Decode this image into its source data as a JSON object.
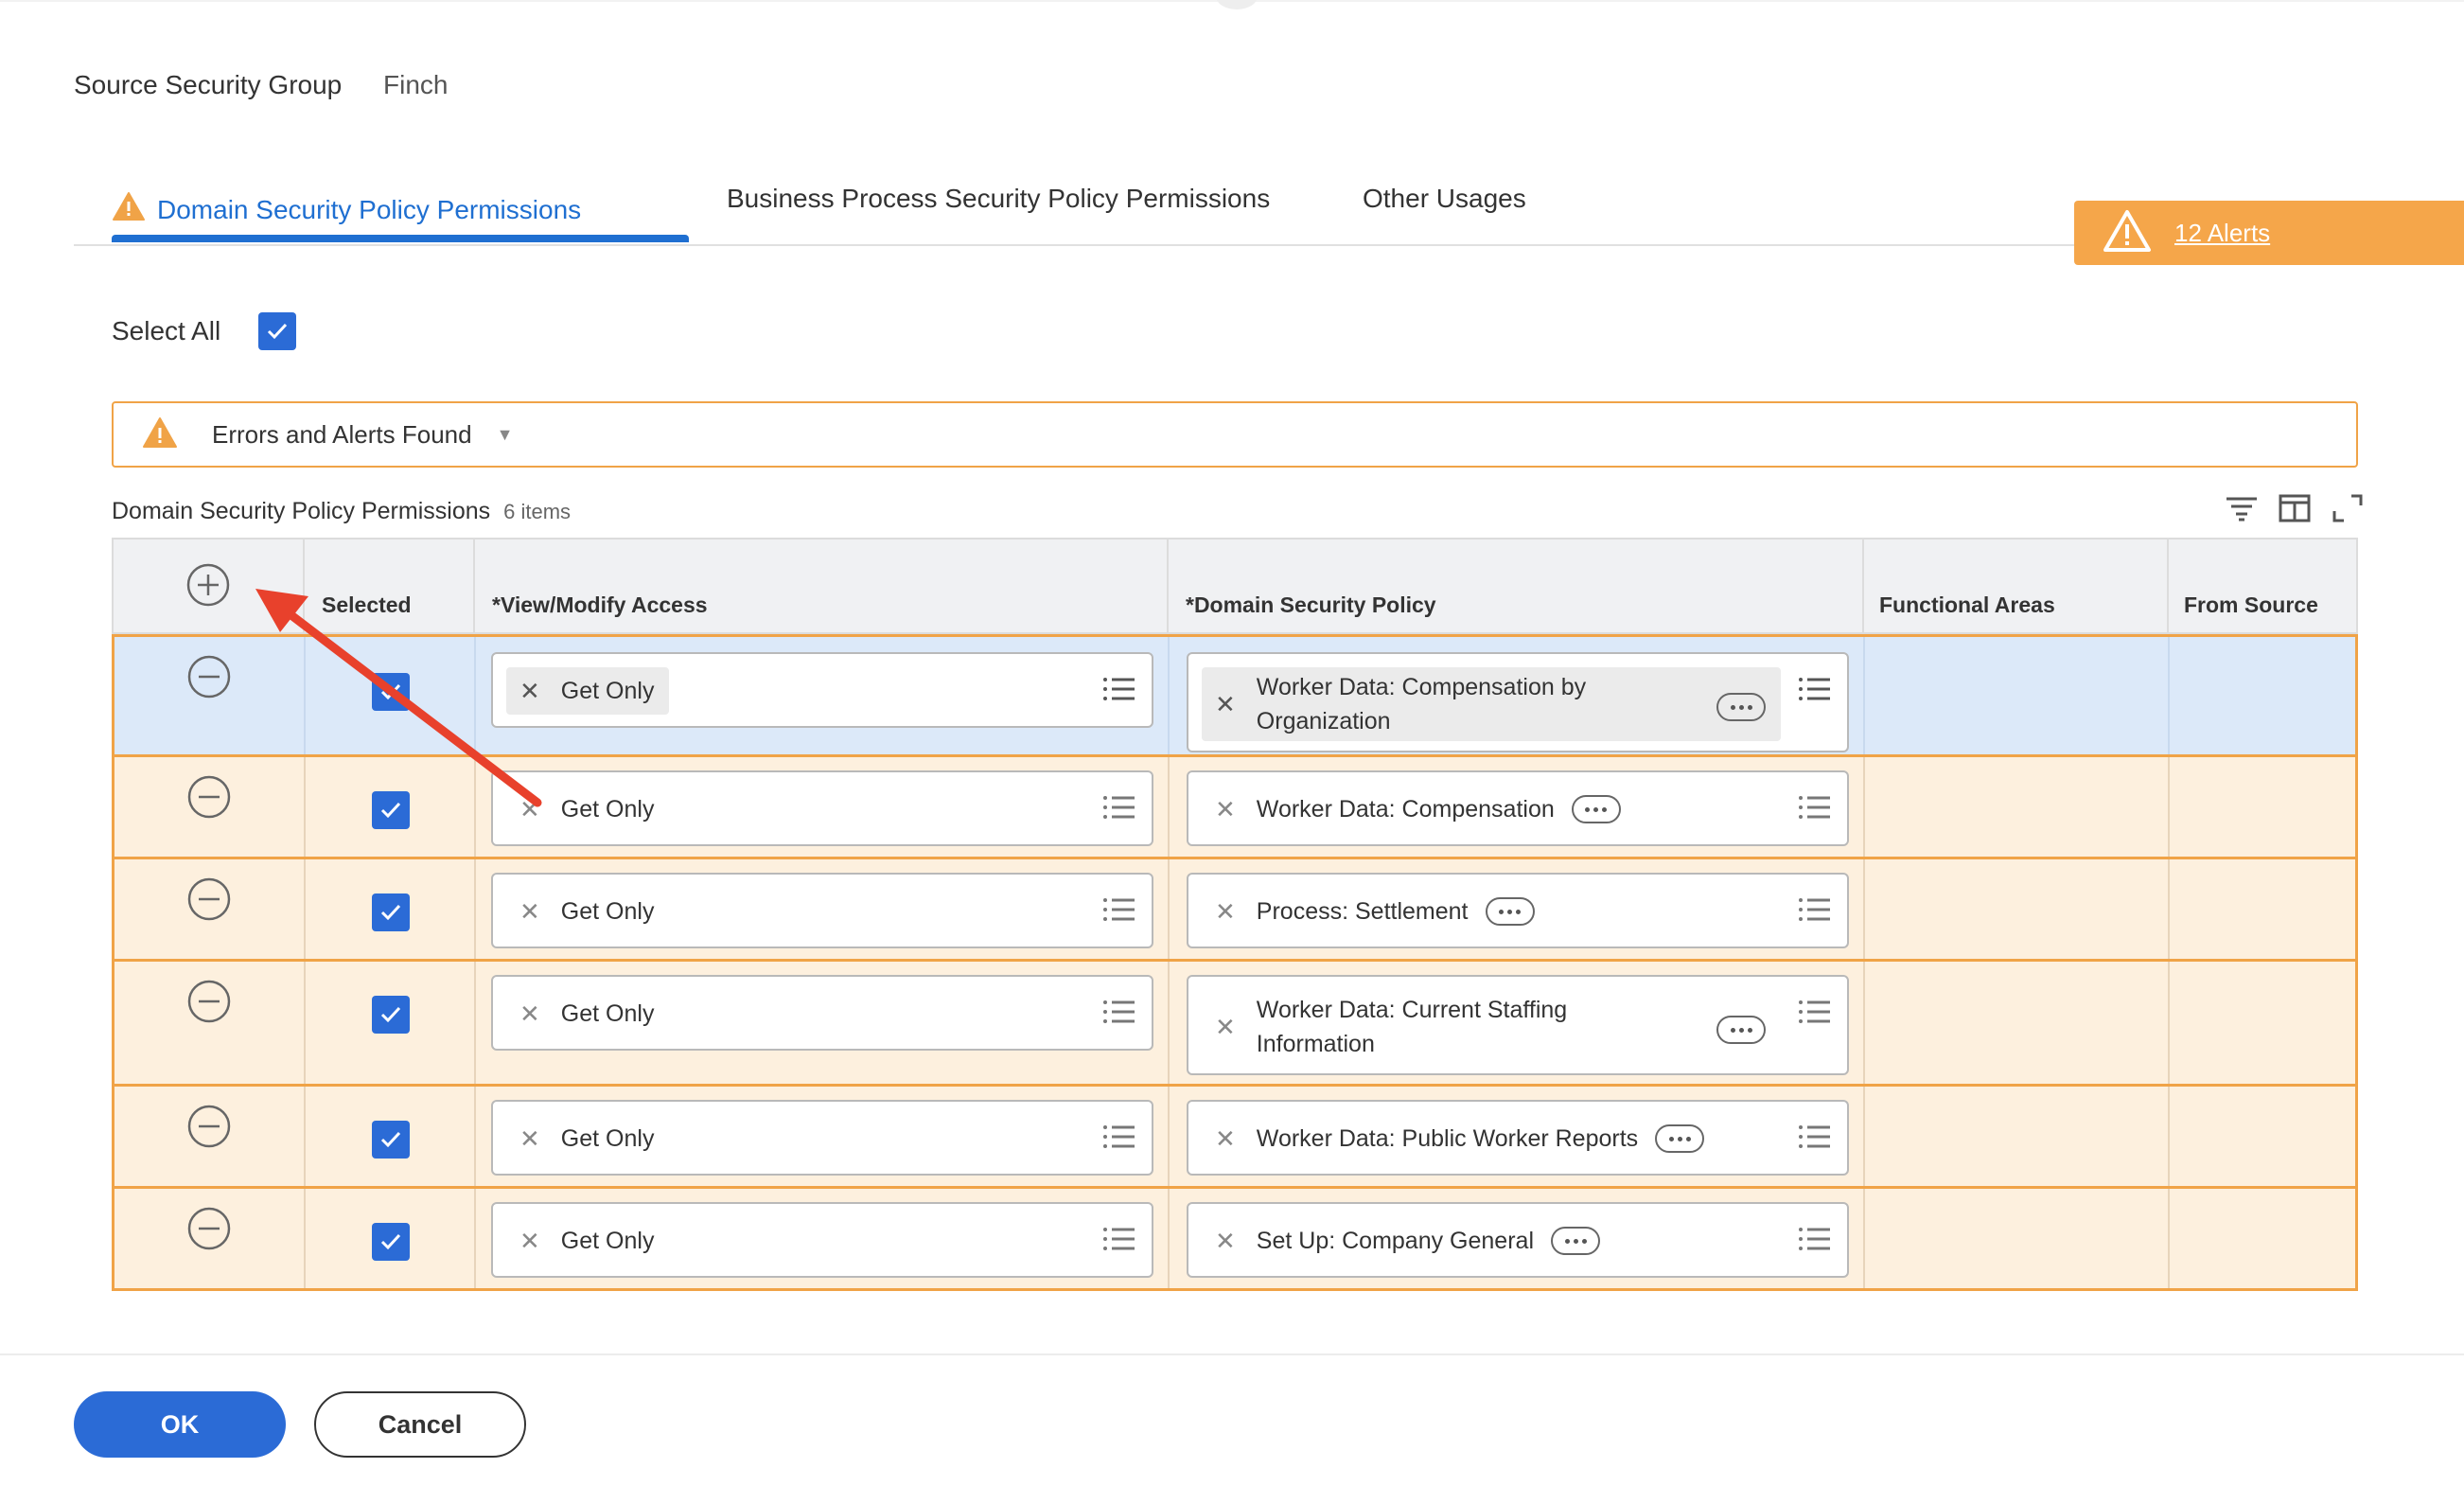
{
  "source": {
    "label": "Source Security Group",
    "value": "Finch"
  },
  "tabs": [
    {
      "label": "Domain Security Policy Permissions",
      "active": true,
      "icon": "warning-icon"
    },
    {
      "label": "Business Process Security Policy Permissions",
      "active": false
    },
    {
      "label": "Other Usages",
      "active": false
    }
  ],
  "alerts": {
    "label": "12 Alerts",
    "icon": "warning-icon",
    "color": "#f5a64a"
  },
  "select_all": {
    "label": "Select All",
    "checked": true
  },
  "errors_box": {
    "label": "Errors and Alerts Found",
    "icon": "warning-icon"
  },
  "grid": {
    "title": "Domain Security Policy Permissions",
    "count": "6 items",
    "tools": [
      "filter-icon",
      "columns-icon",
      "fullscreen-icon"
    ],
    "columns": [
      "Selected",
      "*View/Modify Access",
      "*Domain Security Policy",
      "Functional Areas",
      "From Source"
    ],
    "rows": [
      {
        "selected": true,
        "access": "Get Only",
        "domain_line1": "Worker Data: Compensation by",
        "domain_line2": "Organization",
        "functional_areas": "",
        "from_source": ""
      },
      {
        "selected": true,
        "access": "Get Only",
        "domain_line1": "Worker Data: Compensation",
        "domain_line2": "",
        "functional_areas": "",
        "from_source": ""
      },
      {
        "selected": true,
        "access": "Get Only",
        "domain_line1": "Process: Settlement",
        "domain_line2": "",
        "functional_areas": "",
        "from_source": ""
      },
      {
        "selected": true,
        "access": "Get Only",
        "domain_line1": "Worker Data: Current Staffing",
        "domain_line2": "Information",
        "functional_areas": "",
        "from_source": ""
      },
      {
        "selected": true,
        "access": "Get Only",
        "domain_line1": "Worker Data: Public Worker Reports",
        "domain_line2": "",
        "functional_areas": "",
        "from_source": ""
      },
      {
        "selected": true,
        "access": "Get Only",
        "domain_line1": "Set Up: Company General",
        "domain_line2": "",
        "functional_areas": "",
        "from_source": ""
      }
    ]
  },
  "buttons": {
    "ok": "OK",
    "cancel": "Cancel"
  },
  "colors": {
    "primary": "#2b6bd6",
    "warning": "#f0a347",
    "row_bg": "#fdf0de",
    "selected_row_bg": "#dce9f9"
  }
}
